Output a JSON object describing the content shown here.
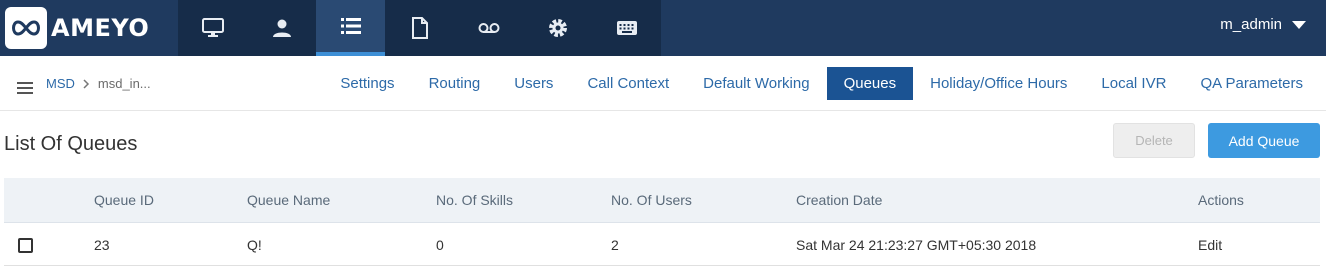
{
  "brand": {
    "logo_text": "AMEYO"
  },
  "topnav": {
    "icons": [
      "monitor-icon",
      "user-icon",
      "list-icon",
      "document-icon",
      "voicemail-icon",
      "gear-icon",
      "keyboard-icon"
    ],
    "active_index": 2,
    "user_label": "m_admin"
  },
  "breadcrumb": {
    "root": "MSD",
    "current": "msd_in..."
  },
  "tabs": [
    {
      "label": "Settings"
    },
    {
      "label": "Routing"
    },
    {
      "label": "Users"
    },
    {
      "label": "Call Context"
    },
    {
      "label": "Default Working"
    },
    {
      "label": "Queues"
    },
    {
      "label": "Holiday/Office Hours"
    },
    {
      "label": "Local IVR"
    },
    {
      "label": "QA Parameters"
    }
  ],
  "active_tab": "Queues",
  "page": {
    "title": "List Of Queues",
    "delete_label": "Delete",
    "add_label": "Add Queue"
  },
  "table": {
    "headers": {
      "queue_id": "Queue ID",
      "queue_name": "Queue Name",
      "skills": "No. Of Skills",
      "users": "No. Of Users",
      "created": "Creation Date",
      "actions": "Actions"
    },
    "rows": [
      {
        "queue_id": "23",
        "queue_name": "Q!",
        "skills": "0",
        "users": "2",
        "created": "Sat Mar 24 21:23:27 GMT+05:30 2018",
        "action": "Edit"
      }
    ]
  },
  "colors": {
    "topbar": "#1f3a5f",
    "accent": "#3d9ae0",
    "active_tab": "#1b5393"
  }
}
